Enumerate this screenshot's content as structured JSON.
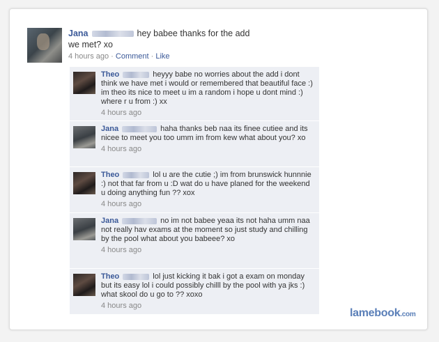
{
  "post": {
    "author": "Jana",
    "text_line1": "hey babee thanks for the add",
    "text_line2": "we met? xo",
    "time": "4 hours ago",
    "comment_link": "Comment",
    "like_link": "Like"
  },
  "comments": [
    {
      "author": "Theo",
      "text": "heyyy babe no worries about the add i dont think we have met i would or remembered that beautiful face :) im theo its nice to meet u im a random i hope u dont mind :) where r u from :) xx",
      "time": "4 hours ago"
    },
    {
      "author": "Jana",
      "text": "haha thanks beb naa its finee cutiee and its nicee to meet you too umm im from kew what about you? xo",
      "time": "4 hours ago"
    },
    {
      "author": "Theo",
      "text": "lol u are the cutie ;) im from brunswick hunnnie :) not that far from u :D wat do u have planed for the weekend u doing anything fun ?? xox",
      "time": "4 hours ago"
    },
    {
      "author": "Jana",
      "text": "no im not babee yeaa its not haha umm naa not really hav exams at the moment so just study and chilling by the pool what about you babeee? xo",
      "time": "4 hours ago"
    },
    {
      "author": "Theo",
      "text": "lol just kicking it bak i got a exam on monday but its easy lol i could possibly chilll by the pool with ya jks :) what skool do u go to ?? xoxo",
      "time": "4 hours ago"
    }
  ],
  "watermark": {
    "brand": "lamebook",
    "suffix": ".com"
  }
}
